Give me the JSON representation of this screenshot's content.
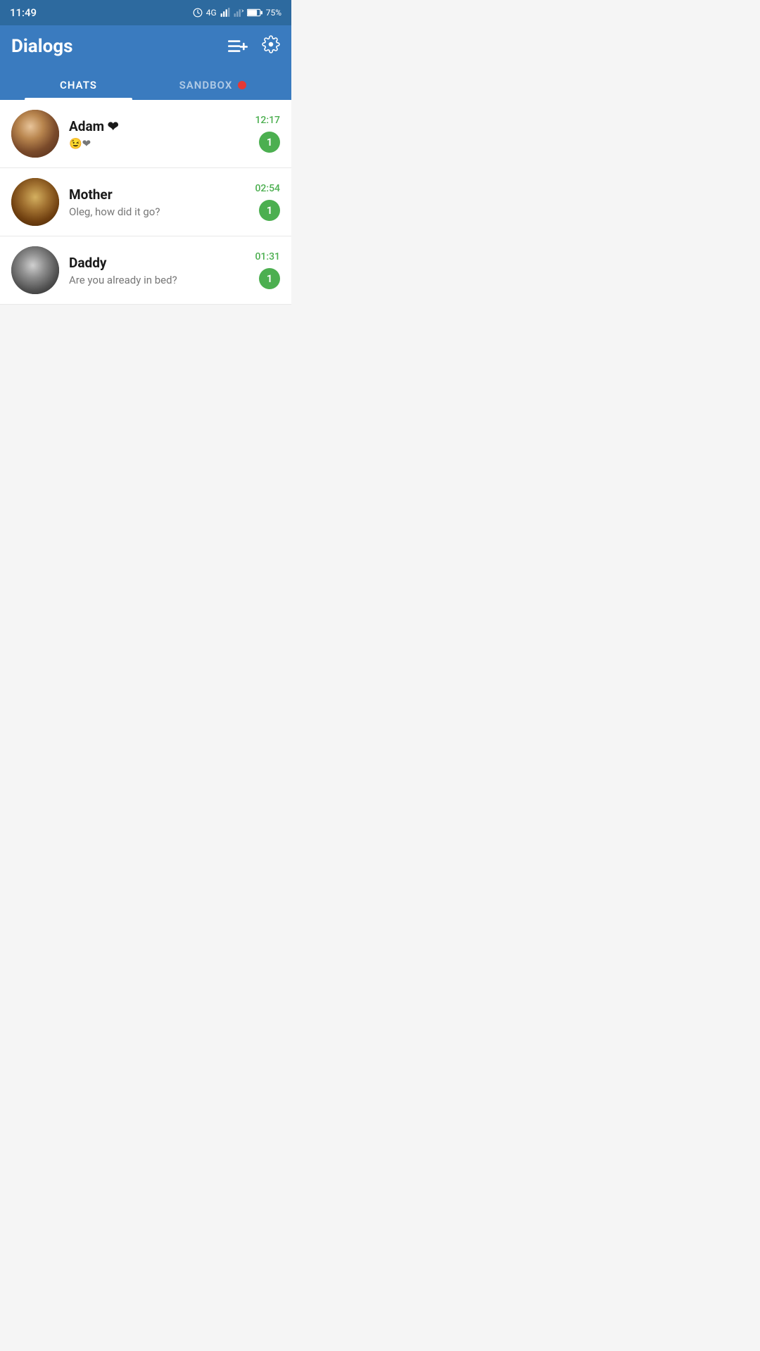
{
  "statusBar": {
    "time": "11:49",
    "network": "4G",
    "battery": "75%"
  },
  "header": {
    "title": "Dialogs",
    "newChatIcon": "≡+",
    "settingsIcon": "⚙"
  },
  "tabs": [
    {
      "id": "chats",
      "label": "CHATS",
      "active": true
    },
    {
      "id": "sandbox",
      "label": "SANDBOX",
      "active": false,
      "hasDot": true
    }
  ],
  "chats": [
    {
      "id": "adam",
      "name": "Adam ❤",
      "preview": "😉❤",
      "time": "12:17",
      "unread": 1,
      "avatarClass": "avatar-adam"
    },
    {
      "id": "mother",
      "name": "Mother",
      "preview": "Oleg, how did it go?",
      "time": "02:54",
      "unread": 1,
      "avatarClass": "avatar-mother"
    },
    {
      "id": "daddy",
      "name": "Daddy",
      "preview": "Are you already in bed?",
      "time": "01:31",
      "unread": 1,
      "avatarClass": "avatar-daddy"
    }
  ]
}
